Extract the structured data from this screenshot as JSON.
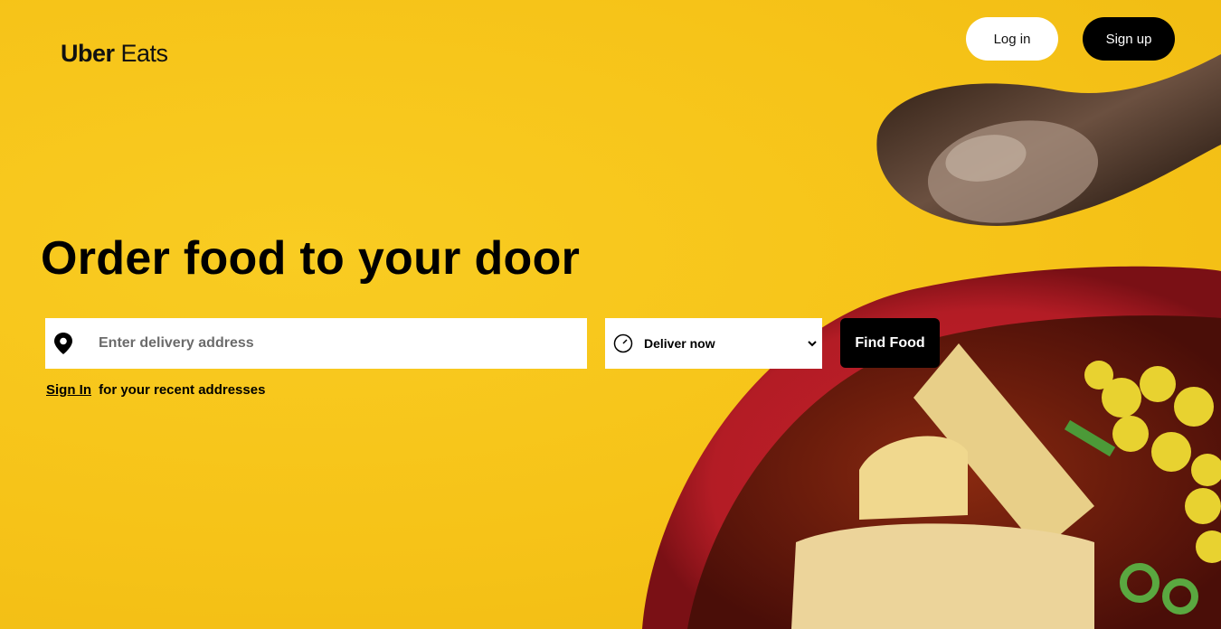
{
  "brand": {
    "name_bold": "Uber",
    "name_regular": " Eats"
  },
  "header": {
    "login_label": "Log in",
    "signup_label": "Sign up"
  },
  "hero": {
    "headline": "Order food to your door",
    "address_placeholder": "Enter delivery address",
    "time_option": "Deliver now",
    "find_button": "Find Food",
    "signin_link": "Sign In",
    "signin_suffix": "for your recent addresses"
  },
  "colors": {
    "background": "#f6c51a",
    "primary_button": "#000000",
    "secondary_button": "#ffffff"
  },
  "icons": [
    "location-pin-icon",
    "clock-icon",
    "chevron-down-icon"
  ]
}
